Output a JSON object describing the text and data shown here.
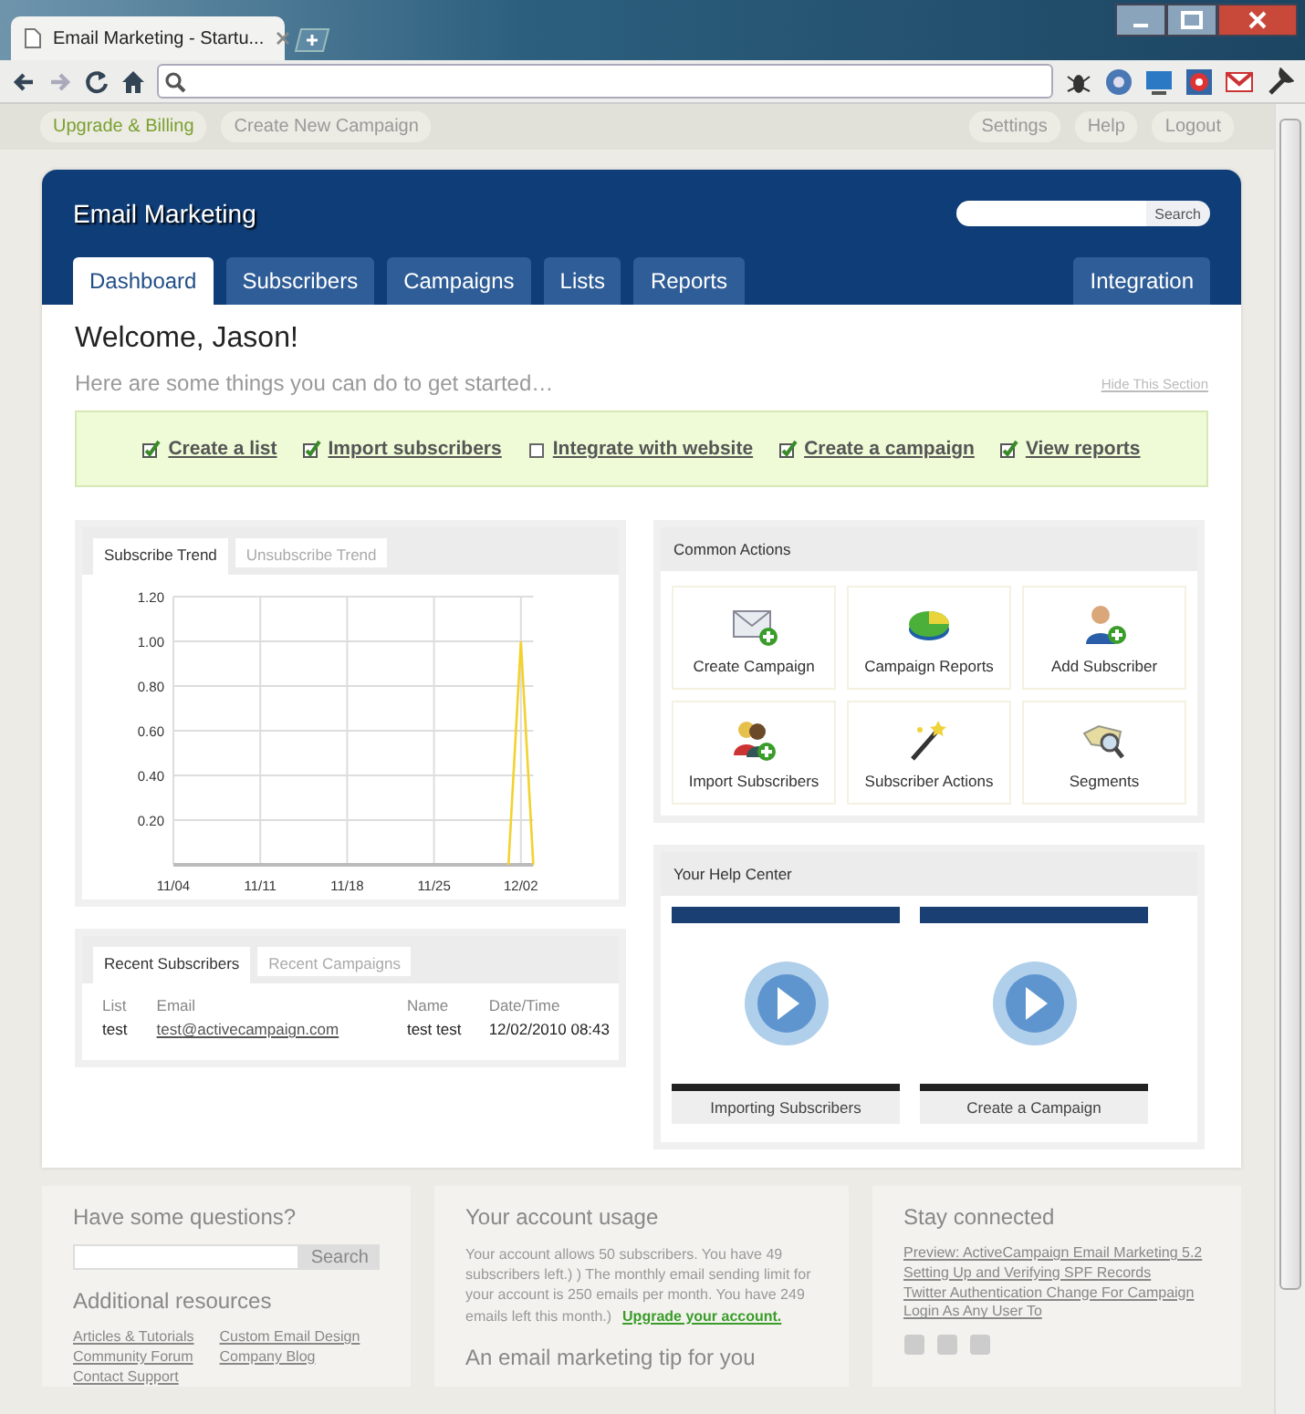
{
  "browser": {
    "tab_title": "Email Marketing - Startu..."
  },
  "top_nav": {
    "left": [
      {
        "label": "Upgrade & Billing",
        "kind": "highlight"
      },
      {
        "label": "Create New Campaign",
        "kind": "plain"
      }
    ],
    "right": [
      "Settings",
      "Help",
      "Logout"
    ]
  },
  "header": {
    "title": "Email Marketing",
    "search_button": "Search"
  },
  "tabs": [
    {
      "label": "Dashboard",
      "selected": true
    },
    {
      "label": "Subscribers",
      "selected": false
    },
    {
      "label": "Campaigns",
      "selected": false
    },
    {
      "label": "Lists",
      "selected": false
    },
    {
      "label": "Reports",
      "selected": false
    }
  ],
  "right_tabs": [
    {
      "label": "Integration",
      "selected": false
    }
  ],
  "welcome": {
    "heading": "Welcome, Jason!",
    "subtitle": "Here are some things you can do to get started…",
    "hide_link": "Hide This Section",
    "steps": [
      {
        "label": "Create a list",
        "checked": true
      },
      {
        "label": "Import subscribers",
        "checked": true
      },
      {
        "label": "Integrate with website",
        "checked": false
      },
      {
        "label": "Create a campaign",
        "checked": true
      },
      {
        "label": "View reports",
        "checked": true
      }
    ]
  },
  "trend_panel": {
    "tabs": [
      {
        "label": "Subscribe Trend",
        "selected": true
      },
      {
        "label": "Unsubscribe Trend",
        "selected": false
      }
    ],
    "chart_data": {
      "type": "line",
      "categories": [
        "11/04",
        null,
        null,
        null,
        null,
        null,
        null,
        "11/11",
        null,
        null,
        null,
        null,
        null,
        null,
        "11/18",
        null,
        null,
        null,
        null,
        null,
        null,
        "11/25",
        null,
        null,
        null,
        null,
        null,
        null,
        "12/02",
        null
      ],
      "series": [
        {
          "color": "#f2d22e",
          "values": [
            null,
            null,
            null,
            null,
            null,
            null,
            null,
            null,
            null,
            null,
            null,
            null,
            null,
            null,
            null,
            null,
            null,
            null,
            null,
            null,
            null,
            null,
            null,
            null,
            null,
            null,
            null,
            0,
            1,
            0
          ]
        }
      ],
      "ylim": [
        0,
        1.2
      ],
      "grid": true,
      "yticks": [
        {
          "value": 0.2,
          "label": "0.20"
        },
        {
          "value": 0.4,
          "label": "0.40"
        },
        {
          "value": 0.6,
          "label": "0.60"
        },
        {
          "value": 0.8,
          "label": "0.80"
        },
        {
          "value": 1.0,
          "label": "1.00"
        },
        {
          "value": 1.2,
          "label": "1.20"
        }
      ]
    }
  },
  "recent_panel": {
    "tabs": [
      {
        "label": "Recent Subscribers",
        "selected": true
      },
      {
        "label": "Recent Campaigns",
        "selected": false
      }
    ],
    "columns": [
      "List",
      "Email",
      "Name",
      "Date/Time"
    ],
    "rows": [
      [
        "test",
        "test@activecampaign.com",
        "test test",
        "12/02/2010 08:43"
      ]
    ]
  },
  "common_actions": {
    "title": "Common Actions",
    "items": [
      {
        "label": "Create Campaign",
        "kind": "envelope"
      },
      {
        "label": "Campaign Reports",
        "kind": "pie"
      },
      {
        "label": "Add Subscriber",
        "kind": "person"
      },
      {
        "label": "Import Subscribers",
        "kind": "people"
      },
      {
        "label": "Subscriber Actions",
        "kind": "wand"
      },
      {
        "label": "Segments",
        "kind": "magnifier"
      }
    ]
  },
  "help_center": {
    "title": "Your Help Center",
    "videos": [
      "Importing Subscribers",
      "Create a Campaign"
    ]
  },
  "footer": {
    "questions": {
      "title": "Have some questions?",
      "search_button": "Search",
      "resources_title": "Additional resources",
      "links": [
        "Articles & Tutorials",
        "Custom Email Design",
        "Community Forum",
        "Company Blog",
        "Contact Support"
      ]
    },
    "usage": {
      "title": "Your account usage",
      "text": "Your account allows 50 subscribers. You have 49 subscribers left.) ) The monthly email sending limit for your account is 250 emails per month. You have 249 emails left this month.)",
      "link": "Upgrade your account.",
      "tip_title": "An email marketing tip for you"
    },
    "connected": {
      "title": "Stay connected",
      "links": [
        "Preview: ActiveCampaign Email Marketing 5.2",
        "Setting Up and Verifying SPF Records",
        "Twitter Authentication Change For Campaign",
        "Login As Any User To"
      ]
    }
  }
}
